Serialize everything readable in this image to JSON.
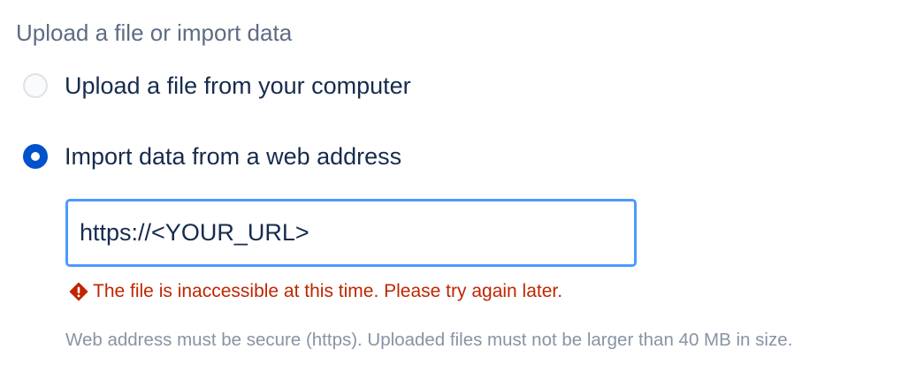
{
  "section": {
    "title": "Upload a file or import data"
  },
  "options": [
    {
      "label": "Upload a file from your computer",
      "checked": false
    },
    {
      "label": "Import data from a web address",
      "checked": true
    }
  ],
  "url_field": {
    "value": "https://<YOUR_URL>"
  },
  "error": {
    "icon": "error-icon",
    "message": "The file is inaccessible at this time. Please try again later."
  },
  "helper": {
    "text": "Web address must be secure (https). Uploaded files must not be larger than 40 MB in size."
  },
  "colors": {
    "accent": "#0052cc",
    "focus_border": "#4c9aff",
    "error": "#bf2600",
    "helper": "#8993a4",
    "title": "#5e6c84"
  }
}
